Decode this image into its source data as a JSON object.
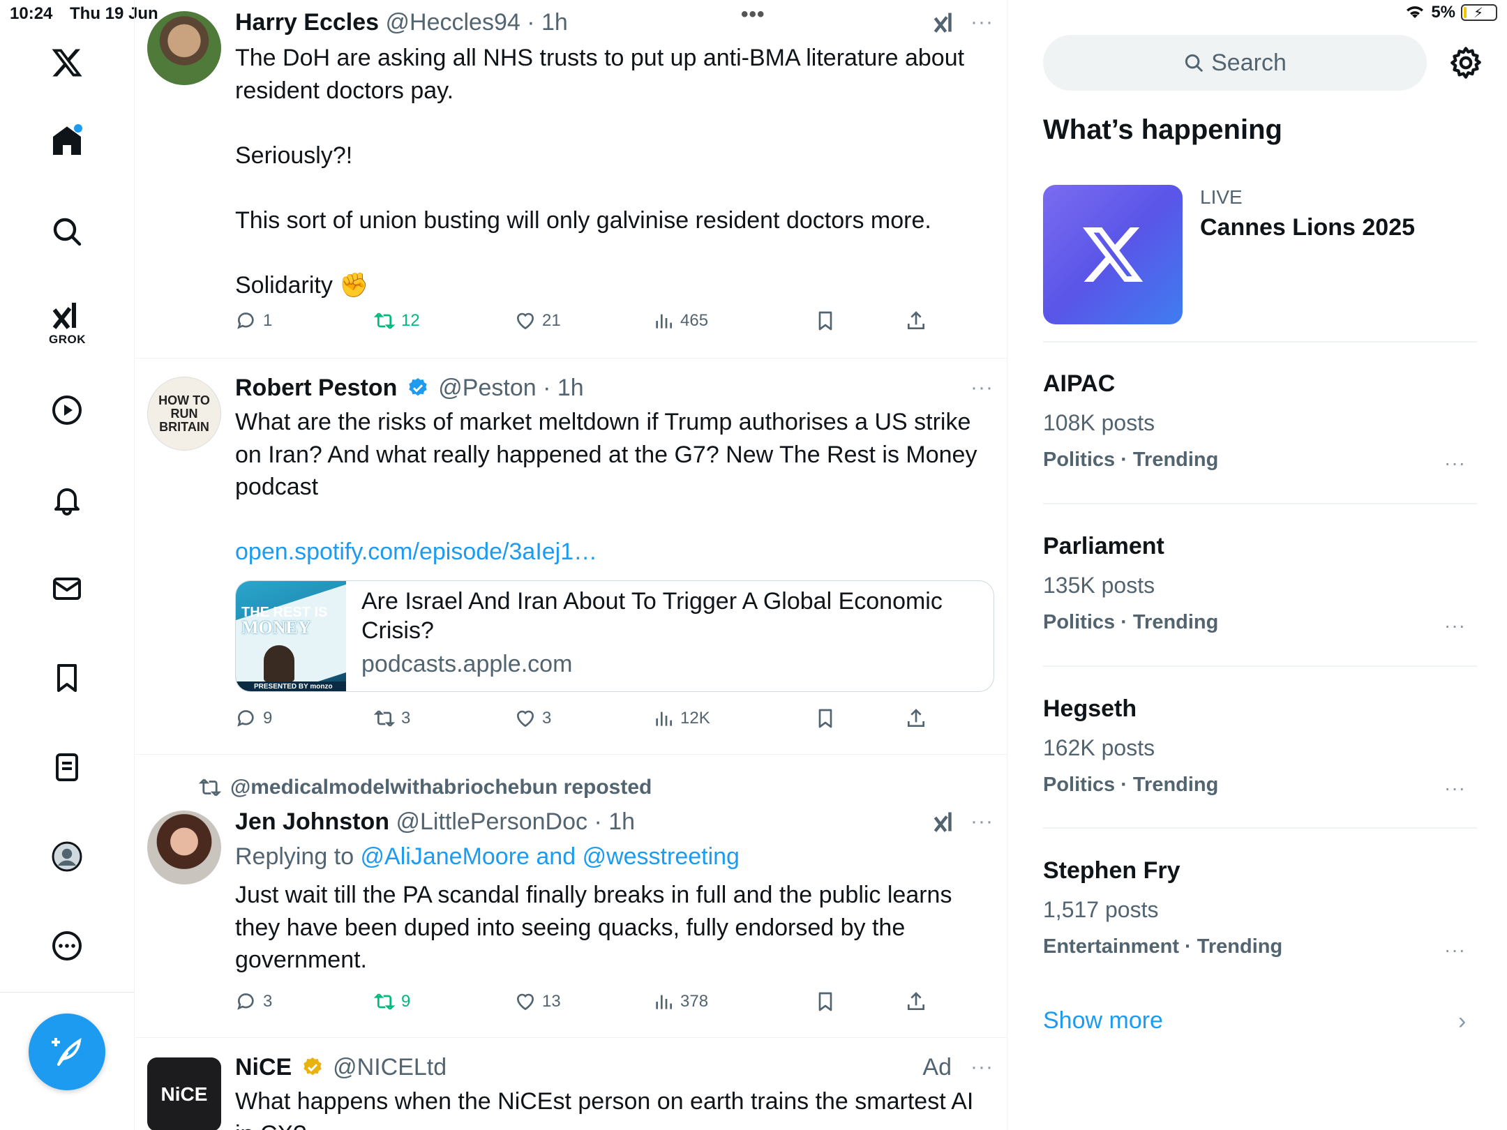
{
  "status_bar": {
    "time": "10:24",
    "date": "Thu 19 Jun",
    "battery": "5%",
    "battery_level": 0.05
  },
  "nav": {
    "grok_label": "GROK"
  },
  "tweets": [
    {
      "name": "Harry Eccles",
      "handle": "@Heccles94",
      "time": "· 1h",
      "body": "The DoH are asking all NHS trusts to put up anti-BMA literature about resident doctors pay.\n\nSeriously?!\n\nThis sort of union busting will only galvinise resident doctors more.\n\nSolidarity ✊",
      "replies": "1",
      "reposts": "12",
      "likes": "21",
      "views": "465"
    },
    {
      "name": "Robert Peston",
      "handle": "@Peston",
      "time": "· 1h",
      "body": "What are the risks of market meltdown if Trump authorises a US strike on Iran? And what really happened at the G7? New The Rest is Money podcast",
      "link": "open.spotify.com/episode/3aIej1…",
      "avatar_text": [
        "HOW TO",
        "RUN",
        "BRITAIN"
      ],
      "card": {
        "title": "Are Israel And Iran About To Trigger A Global Economic Crisis?",
        "domain": "podcasts.apple.com",
        "thumb_title": [
          "THE REST IS",
          "MONEY"
        ],
        "thumb_footer": "PRESENTED BY monzo"
      },
      "replies": "9",
      "reposts": "3",
      "likes": "3",
      "views": "12K"
    },
    {
      "repost_by": "@medicalmodelwithabriochebun reposted",
      "name": "Jen Johnston",
      "handle": "@LittlePersonDoc",
      "time": "· 1h",
      "replying_prefix": "Replying to ",
      "replying_to": "@AliJaneMoore and @wesstreeting",
      "body": "Just wait till the PA scandal finally breaks in full and the public learns they have been duped into seeing quacks, fully endorsed by the government.",
      "replies": "3",
      "reposts": "9",
      "likes": "13",
      "views": "378"
    },
    {
      "name": "NiCE",
      "handle": "@NICELtd",
      "ad_label": "Ad",
      "avatar_text": "NiCE",
      "body": "What happens when the NiCEst person on earth trains the smartest AI in CX?"
    }
  ],
  "sidebar": {
    "search_placeholder": "Search",
    "whats_happening": "What’s happening",
    "live": {
      "label": "LIVE",
      "title": "Cannes Lions 2025"
    },
    "trends": [
      {
        "title": "AIPAC",
        "posts": "108K posts",
        "category": "Politics · Trending"
      },
      {
        "title": "Parliament",
        "posts": "135K posts",
        "category": "Politics · Trending"
      },
      {
        "title": "Hegseth",
        "posts": "162K posts",
        "category": "Politics · Trending"
      },
      {
        "title": "Stephen Fry",
        "posts": "1,517 posts",
        "category": "Entertainment · Trending"
      }
    ],
    "show_more": "Show more"
  },
  "colors": {
    "accent": "#1d9bf0",
    "repost_active": "#00ba7c",
    "secondary_text": "#536471",
    "gold_check": "#e8b20f"
  },
  "icons": [
    "x-logo-icon",
    "home-icon",
    "search-icon",
    "grok-icon",
    "video-icon",
    "bell-icon",
    "mail-icon",
    "bookmark-icon",
    "lists-icon",
    "profile-icon",
    "more-icon",
    "compose-icon",
    "reply-icon",
    "repost-icon",
    "like-icon",
    "views-icon",
    "share-icon",
    "gear-icon",
    "chevron-right-icon"
  ]
}
